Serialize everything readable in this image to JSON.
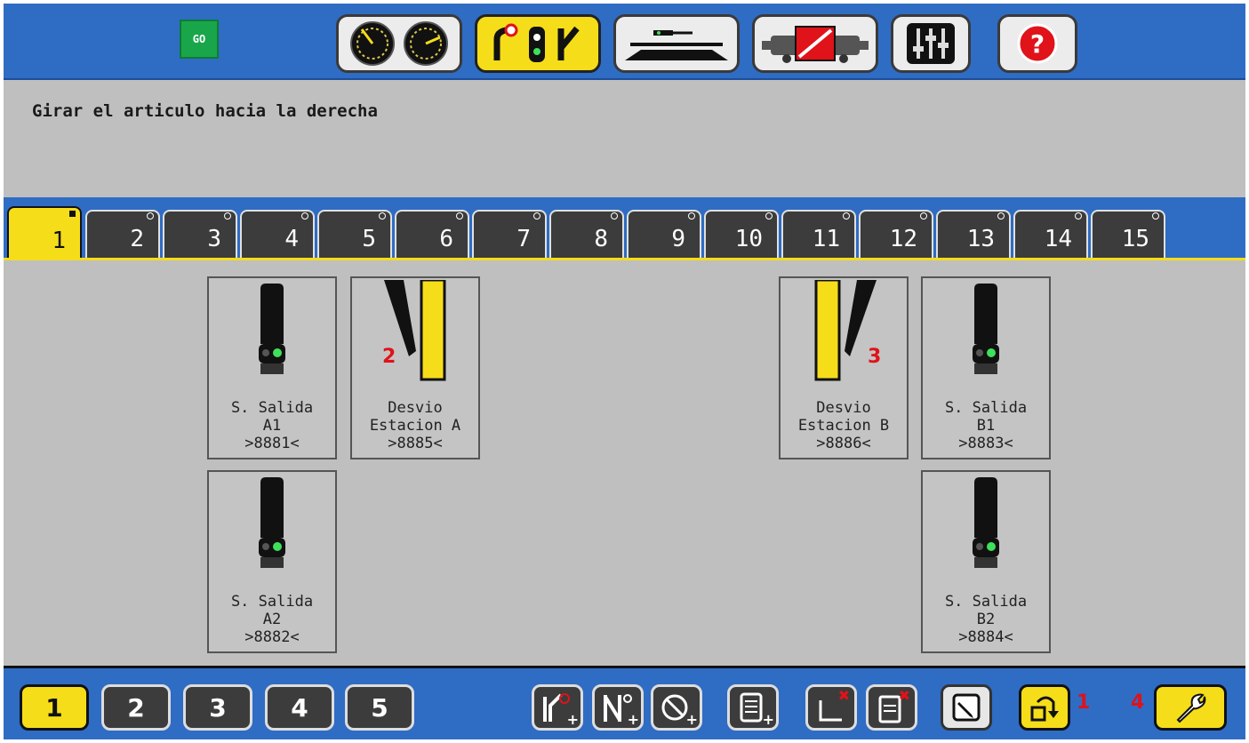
{
  "topbar": {
    "go_label": "GO",
    "buttons": [
      {
        "name": "controller",
        "icon": "speedometer-icon"
      },
      {
        "name": "keyboard",
        "icon": "signal-turnout-icon",
        "active": true
      },
      {
        "name": "layout",
        "icon": "track-layout-icon"
      },
      {
        "name": "locomotive",
        "icon": "loco-edit-icon"
      },
      {
        "name": "settings",
        "icon": "sliders-icon"
      },
      {
        "name": "help",
        "icon": "help-icon",
        "label": "?"
      }
    ]
  },
  "message": "Girar el articulo hacia la derecha",
  "tabs": [
    "1",
    "2",
    "3",
    "4",
    "5",
    "6",
    "7",
    "8",
    "9",
    "10",
    "11",
    "12",
    "13",
    "14",
    "15"
  ],
  "active_tab": "1",
  "tiles": [
    {
      "kind": "signal",
      "line1": "S. Salida",
      "line2": "A1",
      "line3": ">8881<"
    },
    {
      "kind": "turnout-left",
      "line1": "Desvio",
      "line2": "Estacion A",
      "line3": ">8885<",
      "marker": "2"
    },
    {
      "kind": "turnout-right",
      "line1": "Desvio",
      "line2": "Estacion B",
      "line3": ">8886<",
      "marker": "3"
    },
    {
      "kind": "signal",
      "line1": "S. Salida",
      "line2": "B1",
      "line3": ">8883<"
    },
    {
      "kind": "signal",
      "line1": "S. Salida",
      "line2": "A2",
      "line3": ">8882<"
    },
    {
      "kind": "signal",
      "line1": "S. Salida",
      "line2": "B2",
      "line3": ">8884<"
    }
  ],
  "pages": [
    "1",
    "2",
    "3",
    "4",
    "5"
  ],
  "active_page": "1",
  "toolbar": {
    "marker_rotate": "1",
    "marker_wrench": "4",
    "plus": "+",
    "x": "✖"
  },
  "colors": {
    "accent_blue": "#2f6cc4",
    "active_yellow": "#f6dd1a",
    "go_green": "#19a64b",
    "marker_red": "#e0121a"
  }
}
